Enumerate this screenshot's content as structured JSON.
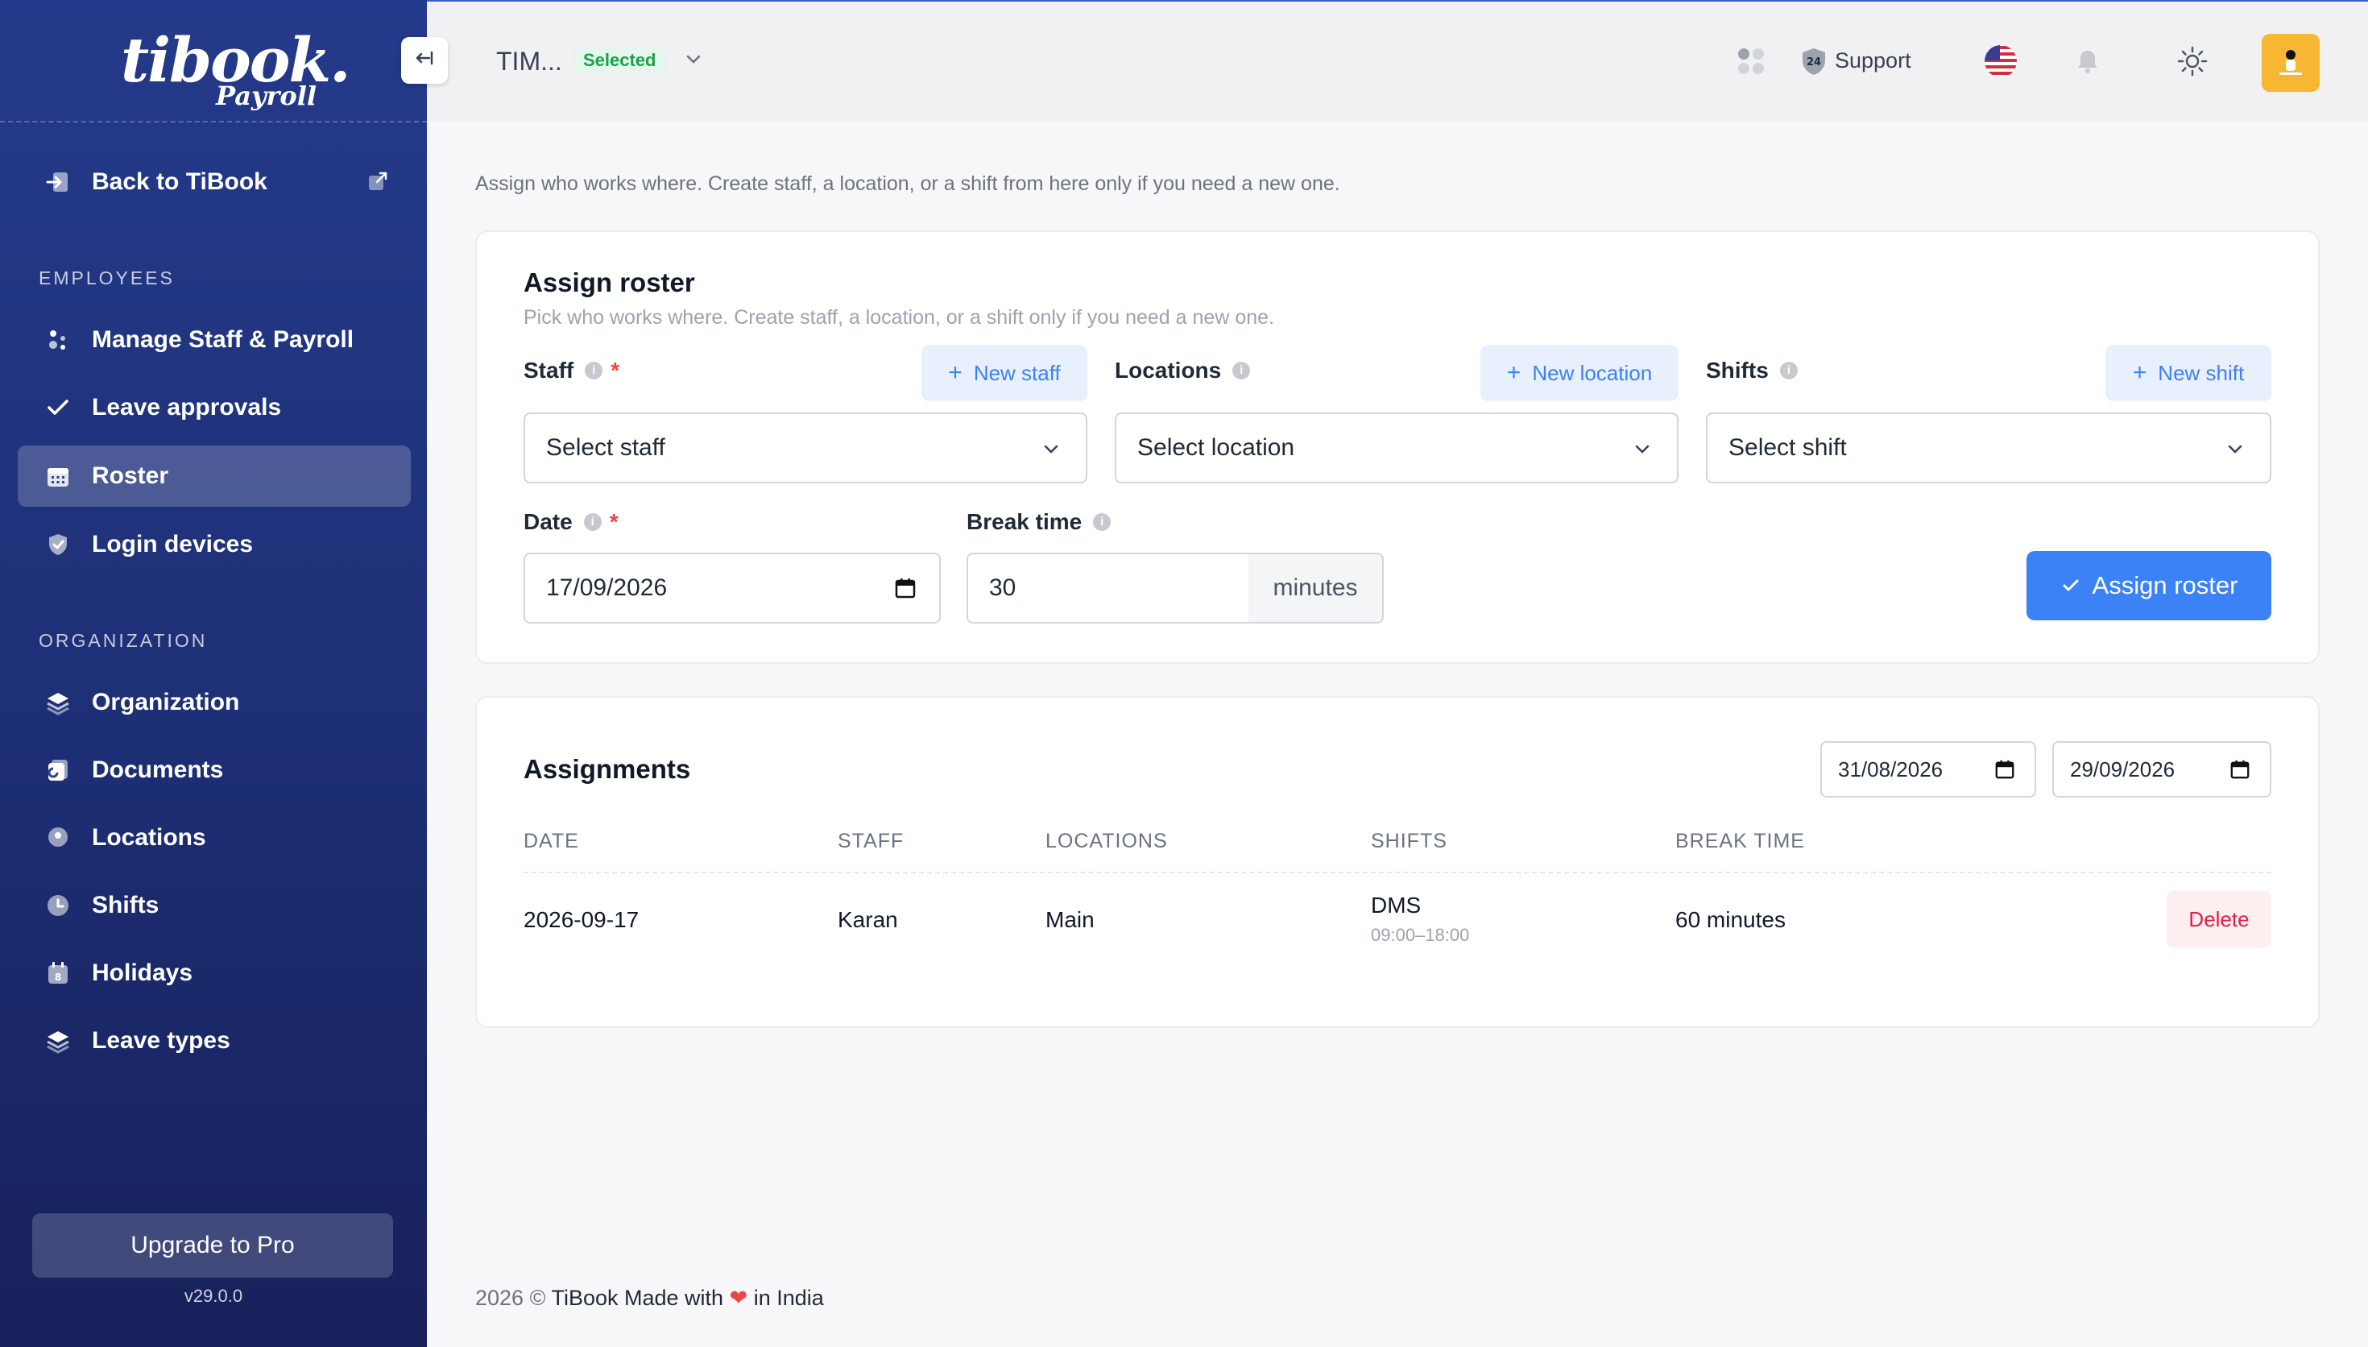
{
  "brand": {
    "logo_text": "tibook.",
    "logo_sub": "Payroll"
  },
  "sidebar": {
    "back_label": "Back to TiBook",
    "sections": {
      "employees": "EMPLOYEES",
      "organization": "ORGANIZATION"
    },
    "items": [
      {
        "label": "Manage Staff & Payroll",
        "icon": "people-icon"
      },
      {
        "label": "Leave approvals",
        "icon": "check-icon"
      },
      {
        "label": "Roster",
        "icon": "calendar-grid-icon",
        "active": true
      },
      {
        "label": "Login devices",
        "icon": "shield-check-icon"
      },
      {
        "label": "Organization",
        "icon": "layers-icon"
      },
      {
        "label": "Documents",
        "icon": "document-icon"
      },
      {
        "label": "Locations",
        "icon": "map-pin-icon"
      },
      {
        "label": "Shifts",
        "icon": "clock-icon"
      },
      {
        "label": "Holidays",
        "icon": "calendar-icon"
      },
      {
        "label": "Leave types",
        "icon": "layers-icon"
      }
    ],
    "upgrade_label": "Upgrade to Pro",
    "version": "v29.0.0"
  },
  "topbar": {
    "org_name": "TIM...",
    "org_badge": "Selected",
    "support_label": "Support",
    "support_badge": "24",
    "avatar_color": "#f7b733"
  },
  "intro": "Assign who works where. Create staff, a location, or a shift from here only if you need a new one.",
  "assign_card": {
    "title": "Assign roster",
    "subtitle": "Pick who works where. Create staff, a location, or a shift only if you need a new one.",
    "staff_label": "Staff",
    "staff_new": "New staff",
    "staff_placeholder": "Select staff",
    "locations_label": "Locations",
    "locations_new": "New location",
    "locations_placeholder": "Select location",
    "shifts_label": "Shifts",
    "shifts_new": "New shift",
    "shifts_placeholder": "Select shift",
    "date_label": "Date",
    "date_value": "17/09/2026",
    "break_label": "Break time",
    "break_value": "30",
    "break_unit": "minutes",
    "submit_label": "Assign roster",
    "required_mark": "*",
    "info_mark": "i"
  },
  "assignments": {
    "title": "Assignments",
    "from_date": "31/08/2026",
    "to_date": "29/09/2026",
    "columns": [
      "DATE",
      "STAFF",
      "LOCATIONS",
      "SHIFTS",
      "BREAK TIME"
    ],
    "rows": [
      {
        "date": "2026-09-17",
        "staff": "Karan",
        "location": "Main",
        "shift": "DMS",
        "shift_time": "09:00–18:00",
        "break": "60 minutes",
        "action": "Delete"
      }
    ]
  },
  "footer": {
    "year": "2026 ©",
    "made_with": "TiBook Made with",
    "in_india": "in India"
  },
  "colors": {
    "sidebar": "#243a8a",
    "primary": "#3b82f6",
    "danger": "#e11d48",
    "success": "#16a34a"
  }
}
